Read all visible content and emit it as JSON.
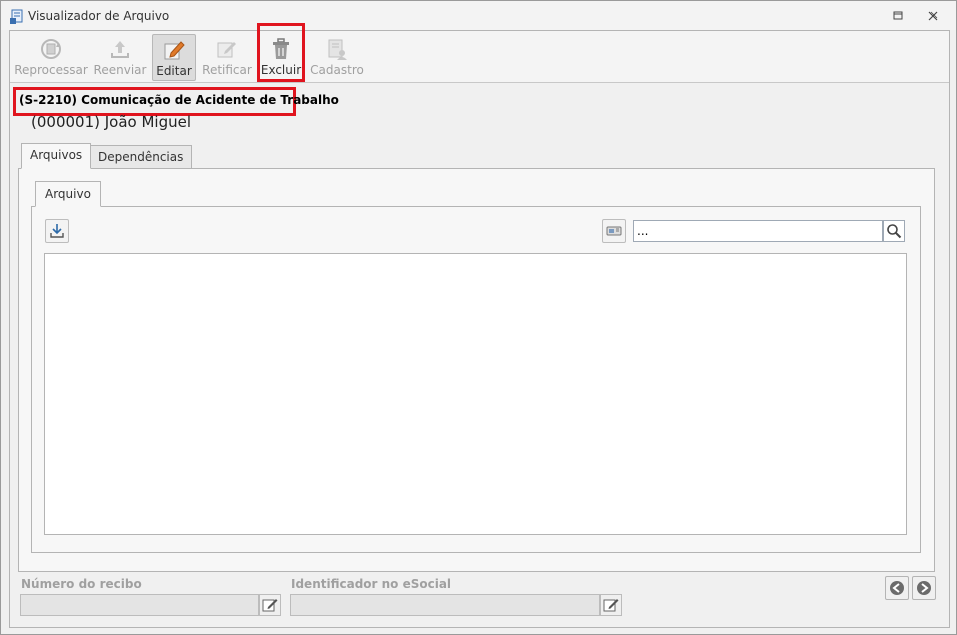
{
  "window": {
    "title": "Visualizador de Arquivo"
  },
  "toolbar": {
    "reprocessar": "Reprocessar",
    "reenviar": "Reenviar",
    "editar": "Editar",
    "retificar": "Retificar",
    "excluir": "Excluir",
    "cadastro": "Cadastro"
  },
  "header": {
    "event_title": "(S-2210) Comunicação de Acidente de Trabalho",
    "person": "(000001) João Miguel"
  },
  "tabs": {
    "arquivos": "Arquivos",
    "dependencias": "Dependências",
    "subtab_arquivo": "Arquivo"
  },
  "search": {
    "value": "..."
  },
  "footer": {
    "numero_recibo_label": "Número do recibo",
    "numero_recibo_value": "",
    "identificador_label": "Identificador no eSocial",
    "identificador_value": ""
  },
  "icons": {
    "title": "document-viewer-icon",
    "reprocessar": "reprocess-icon",
    "reenviar": "upload-icon",
    "editar": "edit-icon",
    "retificar": "rectify-icon",
    "excluir": "trash-icon",
    "cadastro": "register-icon",
    "download": "download-icon",
    "toggle": "toggle-view-icon",
    "search": "search-icon",
    "prev": "arrow-left-icon",
    "next": "arrow-right-icon"
  },
  "colors": {
    "highlight": "#e0141e",
    "window_bg": "#f0f0f0"
  }
}
